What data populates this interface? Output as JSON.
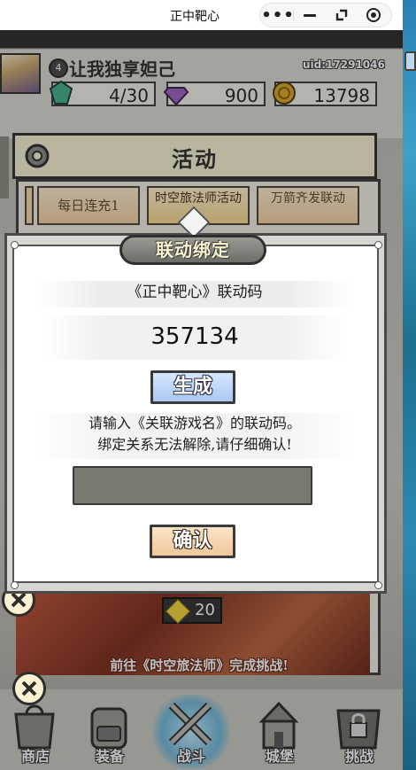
{
  "window": {
    "title": "正中靶心"
  },
  "capsule": {
    "more_icon": "more-dots-icon",
    "minimize_icon": "minimize-icon",
    "restore_icon": "restore-icon",
    "close_icon": "record-close-icon"
  },
  "player": {
    "level": "4",
    "name": "让我独享妲己",
    "uid": "uid:17291046",
    "resources": {
      "energy": {
        "value": "4/30",
        "icon": "green-gem-icon",
        "color": "#3fae8a"
      },
      "diamond": {
        "value": "900",
        "icon": "purple-diamond-icon",
        "color": "#9b5fc0"
      },
      "gold": {
        "value": "13798",
        "icon": "gold-coin-icon",
        "color": "#d9a521"
      }
    }
  },
  "activity": {
    "title": "活动",
    "tabs": [
      {
        "label": "每日连充1"
      },
      {
        "label": "时空旅法师活动"
      },
      {
        "label": "万箭齐发联动"
      }
    ],
    "reward_count": "20",
    "goto_text": "前往《时空旅法师》完成挑战!"
  },
  "modal": {
    "title": "联动绑定",
    "link_label": "《正中靶心》联动码",
    "code": "357134",
    "generate_label": "生成",
    "instruction_line1": "请输入《关联游戏名》的联动码。",
    "instruction_line2": "绑定关系无法解除,请仔细确认!",
    "input_value": "",
    "confirm_label": "确认"
  },
  "bottom_nav": [
    {
      "label": "商店",
      "icon": "shop-bag-icon"
    },
    {
      "label": "装备",
      "icon": "backpack-icon"
    },
    {
      "label": "战斗",
      "icon": "crossed-swords-icon",
      "active": true
    },
    {
      "label": "城堡",
      "icon": "castle-icon"
    },
    {
      "label": "挑战",
      "icon": "locked-challenge-icon"
    }
  ],
  "colors": {
    "accent_blue": "#a9c9f2",
    "accent_tan": "#efc79a",
    "modal_bg": "#ffffff",
    "input_bg": "#797871"
  }
}
